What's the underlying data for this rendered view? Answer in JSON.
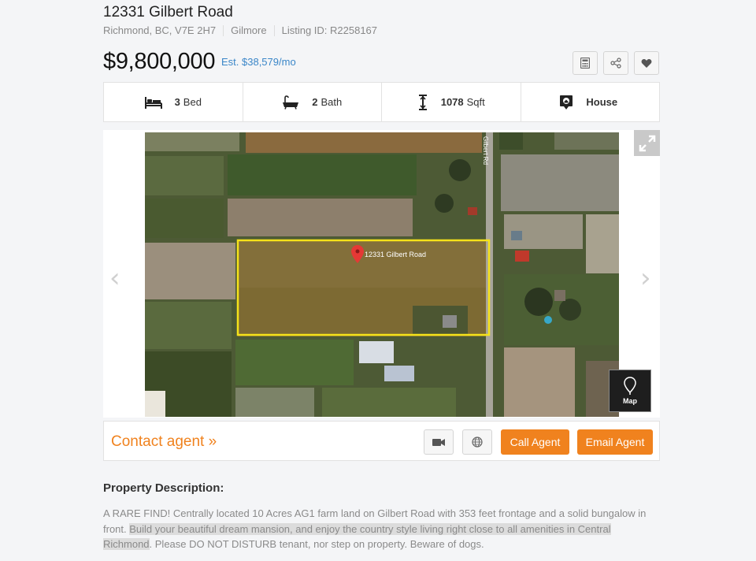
{
  "listing": {
    "address": "12331 Gilbert Road",
    "city": "Richmond, BC, V7E 2H7",
    "area": "Gilmore",
    "listing_id": "Listing ID: R2258167",
    "price": "$9,800,000",
    "estimate": "Est. $38,579/mo"
  },
  "toolbar": {
    "icons": [
      "calculator-icon",
      "share-icon",
      "heart-icon"
    ]
  },
  "features": [
    {
      "icon": "bed-icon",
      "value": "3",
      "label": "Bed"
    },
    {
      "icon": "bathtub-icon",
      "value": "2",
      "label": "Bath"
    },
    {
      "icon": "size-icon",
      "value": "1078",
      "label": "Sqft"
    },
    {
      "icon": "house-pin-icon",
      "value": "",
      "label": "House"
    }
  ],
  "gallery": {
    "map_pin_label": "12331 Gilbert Road",
    "road_label": "Gilbert Rd",
    "map_button_label": "Map"
  },
  "contact": {
    "link": "Contact agent »",
    "call_label": "Call Agent",
    "email_label": "Email Agent"
  },
  "description": {
    "heading": "Property Description:",
    "part1": "A RARE FIND! Centrally located 10 Acres AG1 farm land on Gilbert Road with 353 feet frontage and a solid bungalow in front. ",
    "highlighted": "Build your beautiful dream mansion, and enjoy the country style living right close to all amenities in Central Richmond",
    "part2": ". Please DO NOT DISTURB tenant, nor step on property. Beware of dogs."
  },
  "colors": {
    "accent_orange": "#f0821e",
    "link_blue": "#3a86c8",
    "parcel_outline": "#f5e21a"
  }
}
